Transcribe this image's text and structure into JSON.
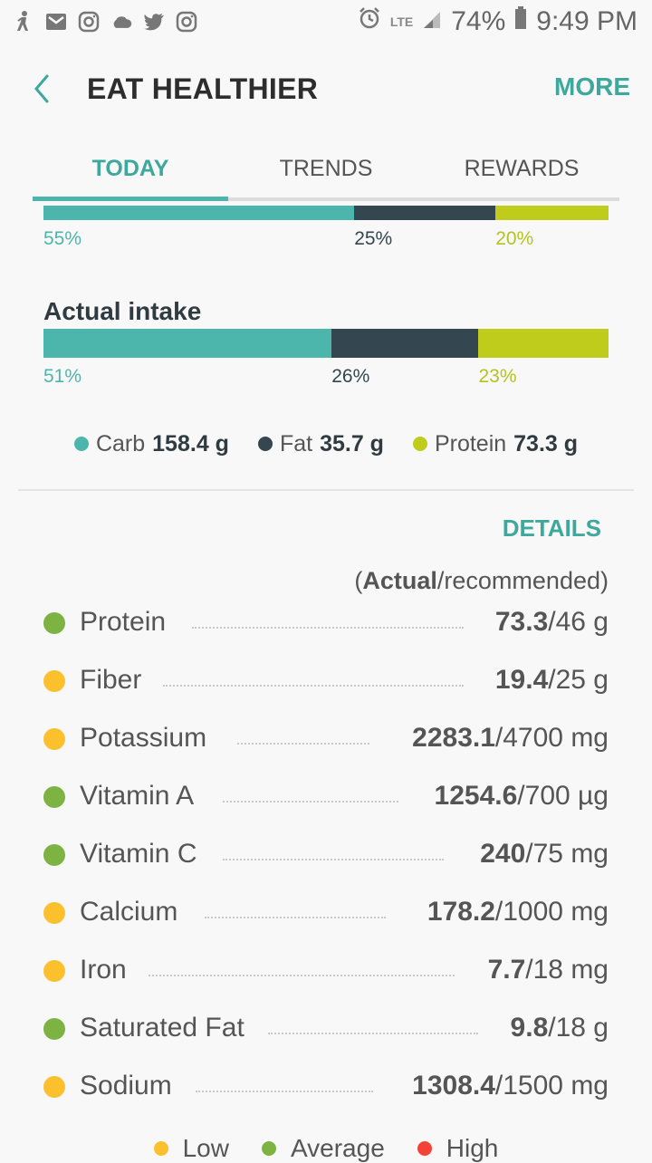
{
  "status_bar": {
    "lte": "LTE",
    "battery": "74%",
    "time": "9:49 PM"
  },
  "header": {
    "title": "EAT HEALTHIER",
    "more_label": "MORE"
  },
  "tabs": [
    {
      "label": "TODAY",
      "active": true
    },
    {
      "label": "TRENDS",
      "active": false
    },
    {
      "label": "REWARDS",
      "active": false
    }
  ],
  "recommended_split": {
    "carb": {
      "percent": 55,
      "label": "55%"
    },
    "fat": {
      "percent": 25,
      "label": "25%"
    },
    "protein": {
      "percent": 20,
      "label": "20%"
    }
  },
  "actual_intake": {
    "title": "Actual intake",
    "carb": {
      "percent": 51,
      "label": "51%"
    },
    "fat": {
      "percent": 26,
      "label": "26%"
    },
    "protein": {
      "percent": 23,
      "label": "23%"
    }
  },
  "macro_legend": [
    {
      "name": "Carb",
      "value": "158.4 g",
      "color": "#4db6ac"
    },
    {
      "name": "Fat",
      "value": "35.7 g",
      "color": "#34464f"
    },
    {
      "name": "Protein",
      "value": "73.3 g",
      "color": "#c0cc1c"
    }
  ],
  "details_label": "DETAILS",
  "note": {
    "open": "(",
    "actual": "Actual",
    "rest": "/recommended)"
  },
  "nutrients": [
    {
      "name": "Protein",
      "actual": "73.3",
      "rec": "/46 g",
      "status": "average"
    },
    {
      "name": "Fiber",
      "actual": "19.4",
      "rec": "/25 g",
      "status": "low"
    },
    {
      "name": "Potassium",
      "actual": "2283.1",
      "rec": "/4700 mg",
      "status": "low"
    },
    {
      "name": "Vitamin A",
      "actual": "1254.6",
      "rec": "/700 µg",
      "status": "average"
    },
    {
      "name": "Vitamin C",
      "actual": "240",
      "rec": "/75 mg",
      "status": "average"
    },
    {
      "name": "Calcium",
      "actual": "178.2",
      "rec": "/1000 mg",
      "status": "low"
    },
    {
      "name": "Iron",
      "actual": "7.7",
      "rec": "/18 mg",
      "status": "low"
    },
    {
      "name": "Saturated Fat",
      "actual": "9.8",
      "rec": "/18 g",
      "status": "average"
    },
    {
      "name": "Sodium",
      "actual": "1308.4",
      "rec": "/1500 mg",
      "status": "low"
    }
  ],
  "status_colors": {
    "low": "#fbc02d",
    "average": "#7cb342",
    "high": "#f44336"
  },
  "bottom_legend": [
    {
      "label": "Low",
      "status": "low"
    },
    {
      "label": "Average",
      "status": "average"
    },
    {
      "label": "High",
      "status": "high"
    }
  ]
}
